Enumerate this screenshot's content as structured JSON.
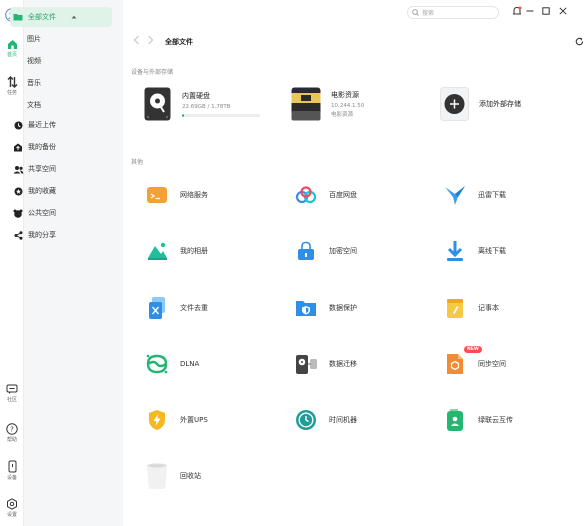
{
  "rail": {
    "items": [
      {
        "label": "首页",
        "icon": "home-icon",
        "active": true
      },
      {
        "label": "任务",
        "icon": "transfer-icon"
      },
      {
        "label": "社区",
        "icon": "community-icon"
      },
      {
        "label": "帮助",
        "icon": "help-icon"
      },
      {
        "label": "设备",
        "icon": "device-icon"
      },
      {
        "label": "设置",
        "icon": "settings-icon"
      }
    ]
  },
  "sidebar": {
    "all_files": "全部文件",
    "subs": [
      "图片",
      "视频",
      "音乐",
      "文档"
    ],
    "items": [
      {
        "label": "最近上传",
        "icon": "recent-upload-icon"
      },
      {
        "label": "我的备份",
        "icon": "backup-icon"
      },
      {
        "label": "共享空间",
        "icon": "shared-space-icon"
      },
      {
        "label": "我的收藏",
        "icon": "favorite-icon"
      },
      {
        "label": "公共空间",
        "icon": "public-space-icon"
      },
      {
        "label": "我的分享",
        "icon": "share-icon"
      }
    ]
  },
  "topbar": {
    "search_placeholder": "搜索"
  },
  "header": {
    "breadcrumb": "全部文件"
  },
  "devices_section": {
    "title": "设备与外部存储",
    "internal": {
      "name": "内置硬盘",
      "usage": "22.69GB / 1.78TB",
      "progress_fraction": 0.0127
    },
    "nas": {
      "name": "电影资源",
      "ip": "10.244.1.50",
      "subtitle": "电影资源"
    },
    "add": {
      "name": "添加外部存储"
    }
  },
  "others_section": {
    "title": "其他",
    "apps": [
      {
        "label": "网络服务",
        "icon": "network-service-icon"
      },
      {
        "label": "百度网盘",
        "icon": "baidu-netdisk-icon"
      },
      {
        "label": "迅雷下载",
        "icon": "thunder-download-icon"
      },
      {
        "label": "我的相册",
        "icon": "photo-album-icon"
      },
      {
        "label": "加密空间",
        "icon": "encrypted-space-icon"
      },
      {
        "label": "离线下载",
        "icon": "offline-download-icon"
      },
      {
        "label": "文件去重",
        "icon": "dedupe-icon"
      },
      {
        "label": "数据保护",
        "icon": "data-protection-icon"
      },
      {
        "label": "记事本",
        "icon": "notepad-icon"
      },
      {
        "label": "DLNA",
        "icon": "dlna-icon"
      },
      {
        "label": "数据迁移",
        "icon": "data-migration-icon"
      },
      {
        "label": "同步空间",
        "icon": "sync-space-icon",
        "badge": "NEW"
      },
      {
        "label": "外置UPS",
        "icon": "ups-icon"
      },
      {
        "label": "时间机器",
        "icon": "time-machine-icon"
      },
      {
        "label": "绿联云互传",
        "icon": "ugreen-transfer-icon"
      },
      {
        "label": "回收站",
        "icon": "recycle-bin-icon"
      }
    ]
  },
  "colors": {
    "accent": "#22b573",
    "active_bg": "#dff3e8",
    "badge": "#ff4d4f"
  }
}
